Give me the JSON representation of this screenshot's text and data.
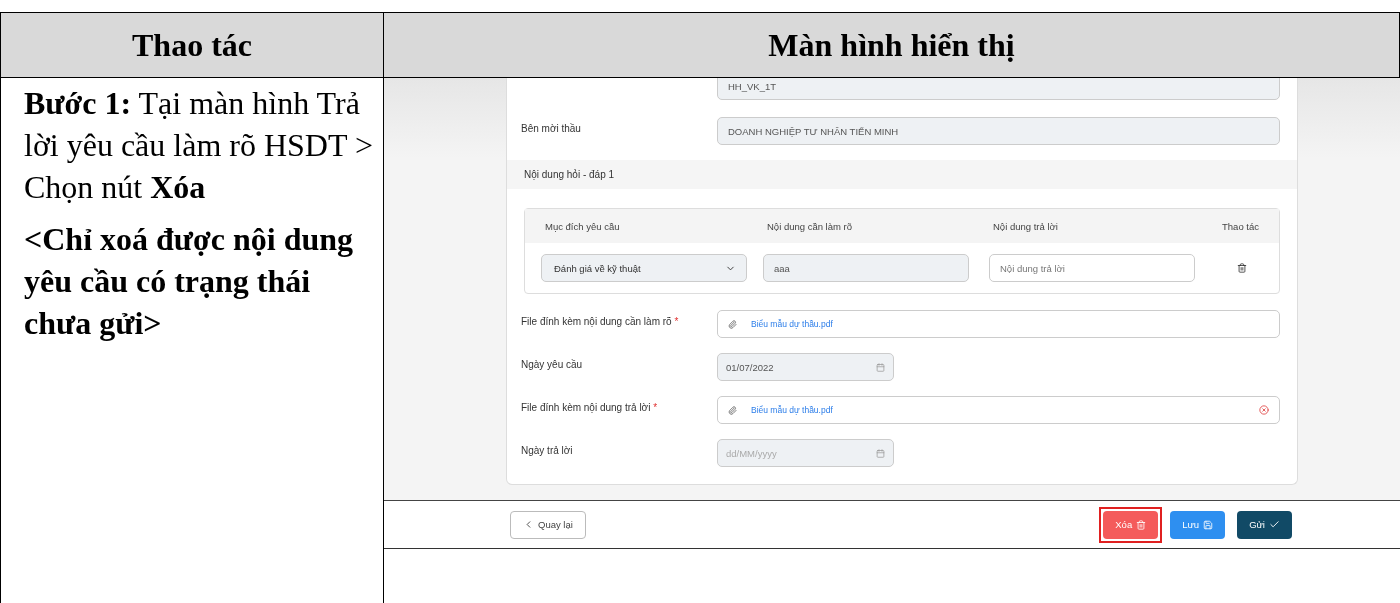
{
  "table": {
    "headers": [
      "Thao tác",
      "Màn hình hiển thị"
    ]
  },
  "step": {
    "text": "**Bước 1:** Tại màn hình Trả lời yêu cầu làm rõ HSDT > Chọn nút **Xóa**",
    "note": "<Chỉ xoá được nội dung yêu cầu có trạng thái chưa gửi>"
  },
  "screen": {
    "package_field": {
      "value": "HH_VK_1T"
    },
    "inviter_field": {
      "label": "Bên mời thầu",
      "value": "DOANH NGHIỆP TƯ NHÂN TIẾN MINH"
    },
    "section_title": "Nội dung hỏi - đáp 1",
    "qa_table": {
      "columns": [
        "Mục đích yêu cầu",
        "Nội dung cần làm rõ",
        "Nội dung trả lời",
        "Thao tác"
      ],
      "rows": [
        {
          "purpose": "Đánh giá về kỹ thuật",
          "content": "aaa",
          "answer_placeholder": "Nội dung trả lời"
        }
      ]
    },
    "fields": [
      {
        "kind": "file",
        "label": "File đính kèm nội dung cần làm rõ",
        "required_mark": "*",
        "value": "Biểu mẫu dự thầu.pdf",
        "removable": false
      },
      {
        "kind": "date",
        "label": "Ngày yêu cầu",
        "value": "01/07/2022"
      },
      {
        "kind": "file",
        "label": "File đính kèm nội dung trả lời",
        "required_mark": "*",
        "value": "Biểu mẫu dự thầu.pdf",
        "removable": true
      },
      {
        "kind": "date",
        "label": "Ngày trả lời",
        "placeholder": "dd/MM/yyyy"
      }
    ],
    "buttons": [
      {
        "kind": "back",
        "label": "Quay lại",
        "highlighted": false
      },
      {
        "kind": "delete",
        "label": "Xóa",
        "highlighted": true
      },
      {
        "kind": "save",
        "label": "Lưu",
        "highlighted": false
      },
      {
        "kind": "send",
        "label": "Gửi",
        "highlighted": false
      }
    ]
  }
}
